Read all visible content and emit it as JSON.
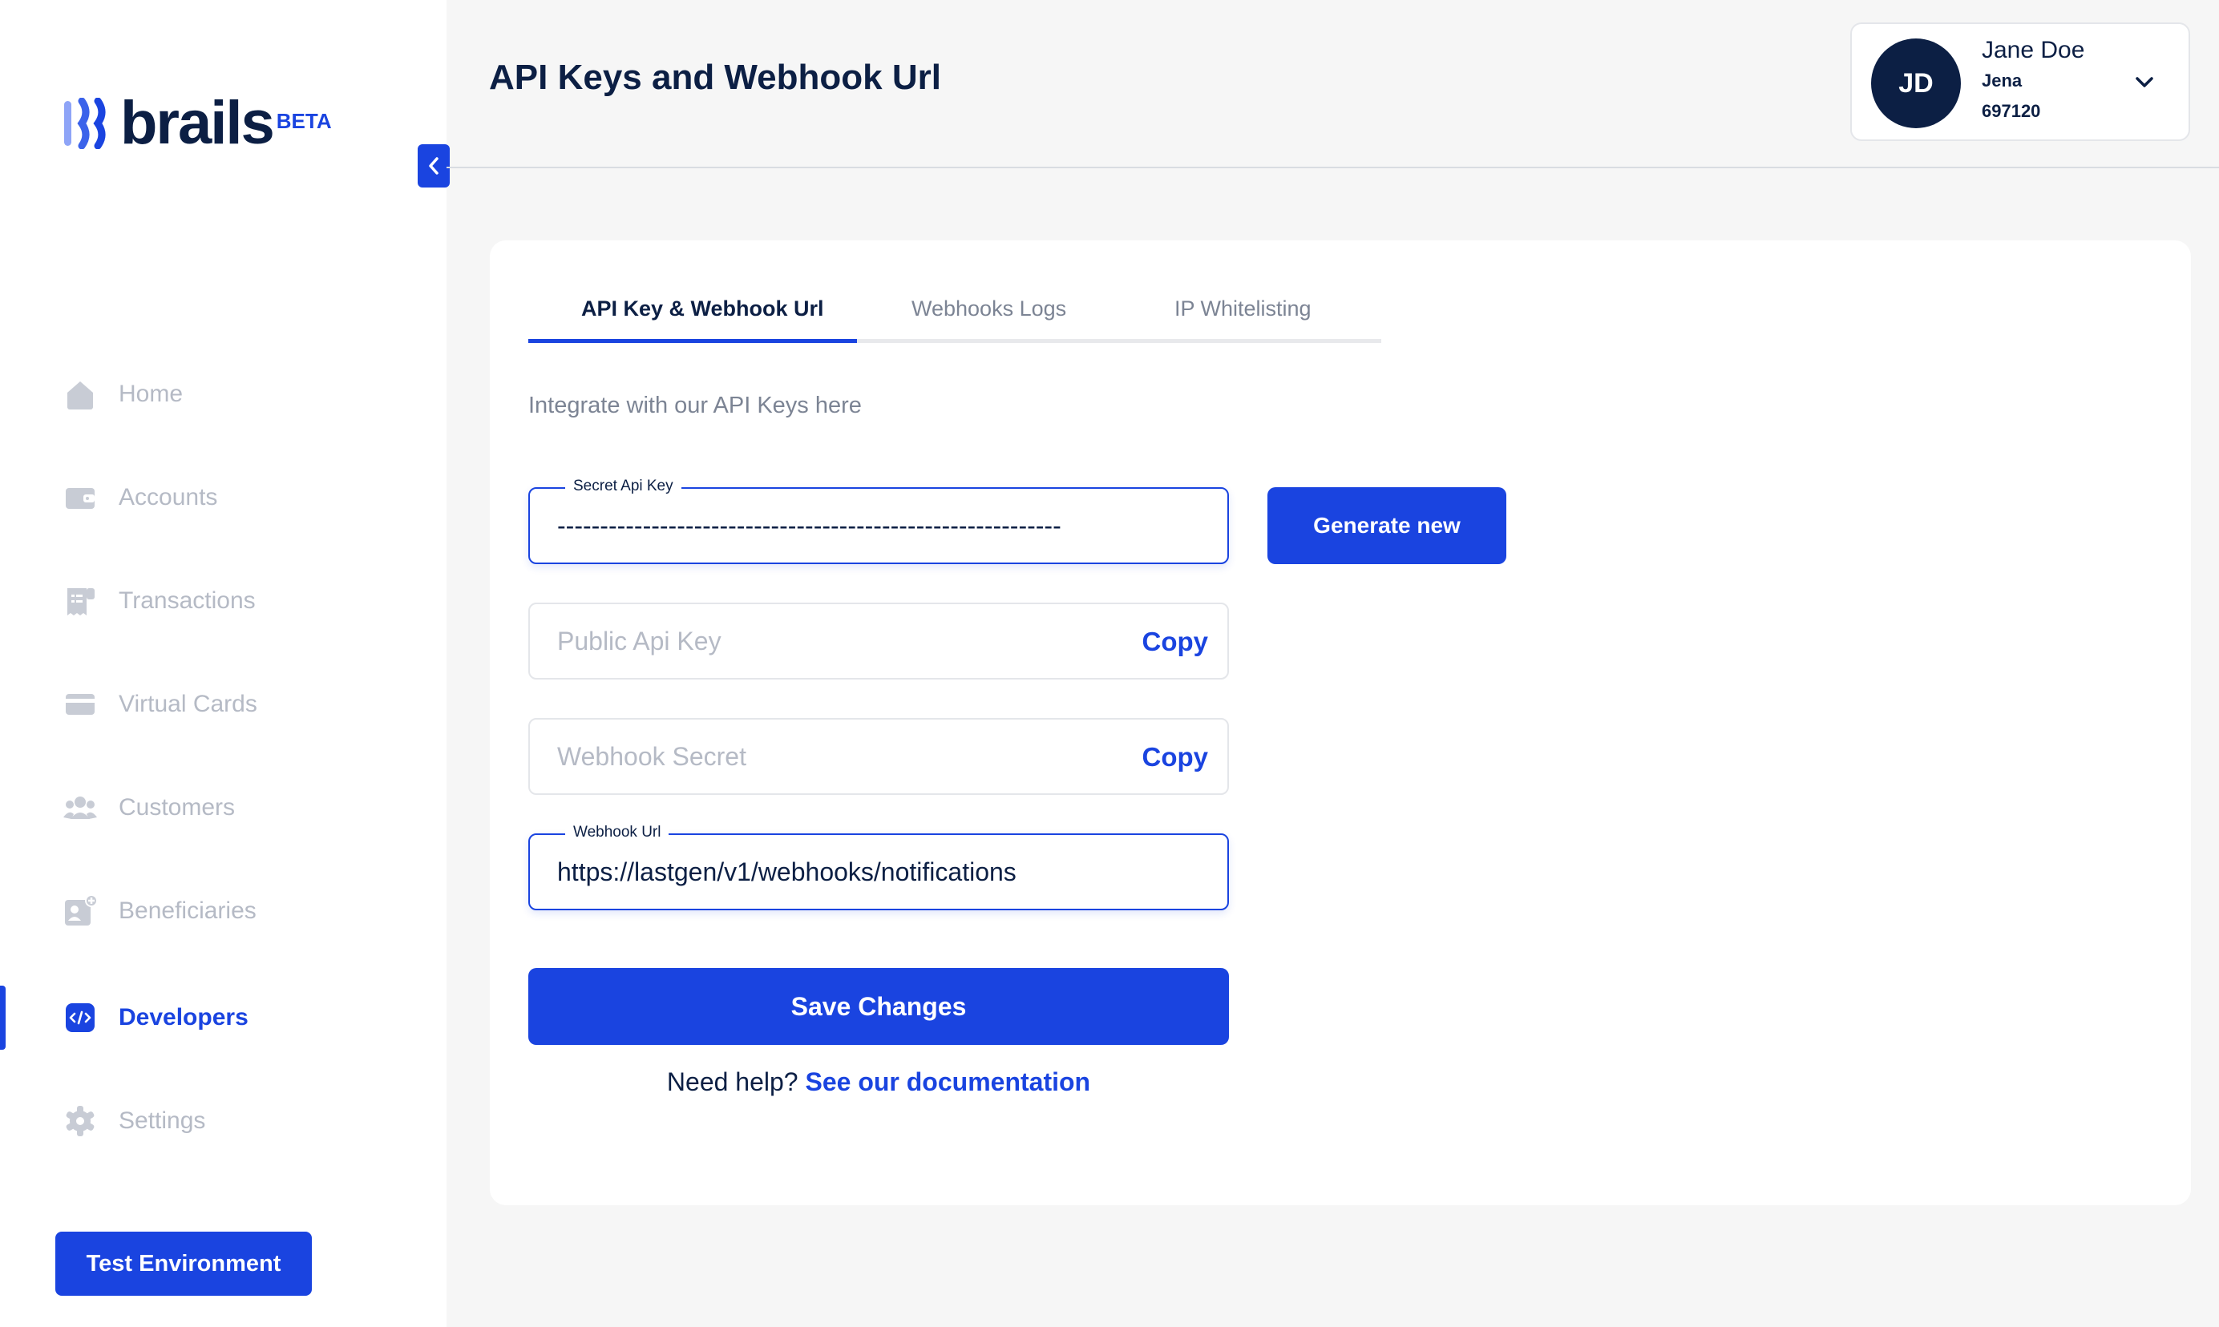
{
  "brand": {
    "name": "brails",
    "badge": "BETA"
  },
  "sidebar": {
    "items": [
      {
        "label": "Home",
        "icon": "home-icon",
        "active": false
      },
      {
        "label": "Accounts",
        "icon": "wallet-icon",
        "active": false
      },
      {
        "label": "Transactions",
        "icon": "receipt-icon",
        "active": false
      },
      {
        "label": "Virtual Cards",
        "icon": "card-icon",
        "active": false
      },
      {
        "label": "Customers",
        "icon": "users-icon",
        "active": false
      },
      {
        "label": "Beneficiaries",
        "icon": "beneficiary-icon",
        "active": false
      },
      {
        "label": "Developers",
        "icon": "code-icon",
        "active": true
      },
      {
        "label": "Settings",
        "icon": "gear-icon",
        "active": false
      }
    ],
    "test_env_label": "Test Environment"
  },
  "header": {
    "title": "API Keys and Webhook Url"
  },
  "user": {
    "initials": "JD",
    "name": "Jane Doe",
    "sub": "Jena",
    "id": "697120"
  },
  "tabs": [
    {
      "label": "API Key & Webhook Url",
      "active": true
    },
    {
      "label": "Webhooks Logs",
      "active": false
    },
    {
      "label": "IP Whitelisting",
      "active": false
    }
  ],
  "content": {
    "intro": "Integrate with our API Keys here",
    "secret_key": {
      "label": "Secret Api Key",
      "value": "-----------------------------------------------------------"
    },
    "generate_label": "Generate new",
    "public_key": {
      "placeholder": "Public Api Key",
      "copy_label": "Copy"
    },
    "webhook_secret": {
      "placeholder": "Webhook Secret",
      "copy_label": "Copy"
    },
    "webhook_url": {
      "label": "Webhook Url",
      "value": "https://lastgen/v1/webhooks/notifications"
    },
    "save_label": "Save Changes",
    "help_text": "Need help?",
    "help_link": "See our documentation"
  },
  "colors": {
    "accent": "#1a44e0",
    "navy": "#0c1f44",
    "muted": "#b5bac5"
  }
}
